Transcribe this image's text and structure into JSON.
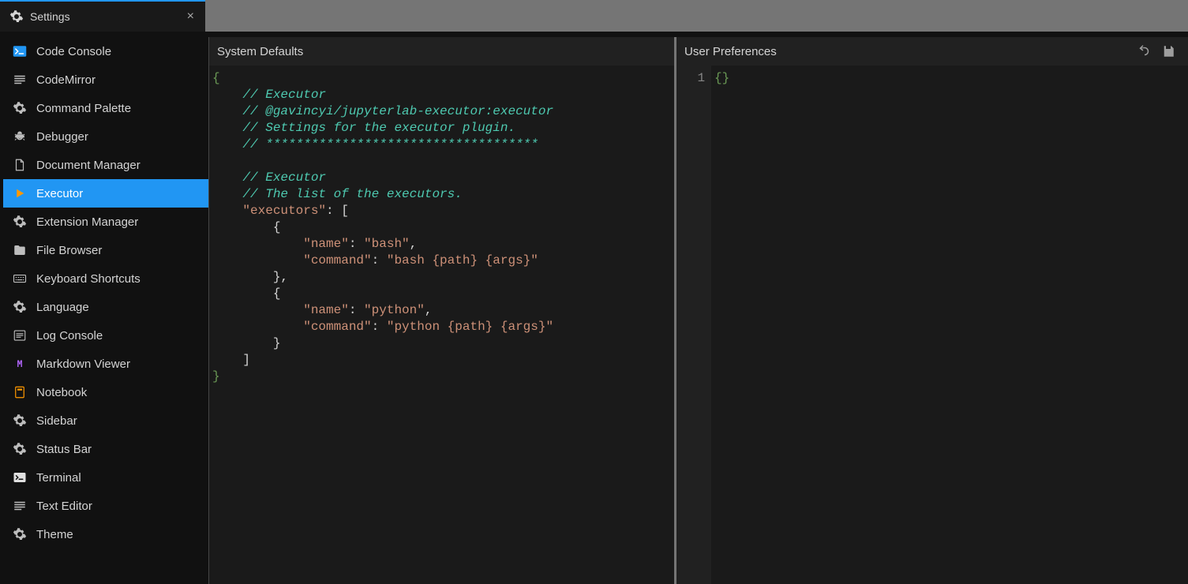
{
  "tab": {
    "title": "Settings",
    "icon": "gear"
  },
  "sidebar": {
    "selected_index": 5,
    "items": [
      {
        "label": "Code Console",
        "icon": "console"
      },
      {
        "label": "CodeMirror",
        "icon": "lines"
      },
      {
        "label": "Command Palette",
        "icon": "gear"
      },
      {
        "label": "Debugger",
        "icon": "bug"
      },
      {
        "label": "Document Manager",
        "icon": "file"
      },
      {
        "label": "Executor",
        "icon": "play"
      },
      {
        "label": "Extension Manager",
        "icon": "gear"
      },
      {
        "label": "File Browser",
        "icon": "folder"
      },
      {
        "label": "Keyboard Shortcuts",
        "icon": "keyboard"
      },
      {
        "label": "Language",
        "icon": "gear"
      },
      {
        "label": "Log Console",
        "icon": "list"
      },
      {
        "label": "Markdown Viewer",
        "icon": "markdown"
      },
      {
        "label": "Notebook",
        "icon": "notebook"
      },
      {
        "label": "Sidebar",
        "icon": "gear"
      },
      {
        "label": "Status Bar",
        "icon": "gear"
      },
      {
        "label": "Terminal",
        "icon": "terminal"
      },
      {
        "label": "Text Editor",
        "icon": "lines"
      },
      {
        "label": "Theme",
        "icon": "gear"
      }
    ]
  },
  "panes": {
    "defaults_title": "System Defaults",
    "user_title": "User Preferences"
  },
  "system_defaults": {
    "comments": [
      "// Executor",
      "// @gavincyi/jupyterlab-executor:executor",
      "// Settings for the executor plugin.",
      "// ************************************",
      "",
      "// Executor",
      "// The list of the executors."
    ],
    "executors": [
      {
        "name": "bash",
        "command": "bash {path} {args}"
      },
      {
        "name": "python",
        "command": "python {path} {args}"
      }
    ]
  },
  "user_preferences": {
    "raw": "{}",
    "line_numbers": [
      "1"
    ]
  },
  "colors": {
    "accent": "#2196f3",
    "bg": "#111111",
    "panel": "#1a1a1a",
    "tabbar": "#757575"
  }
}
